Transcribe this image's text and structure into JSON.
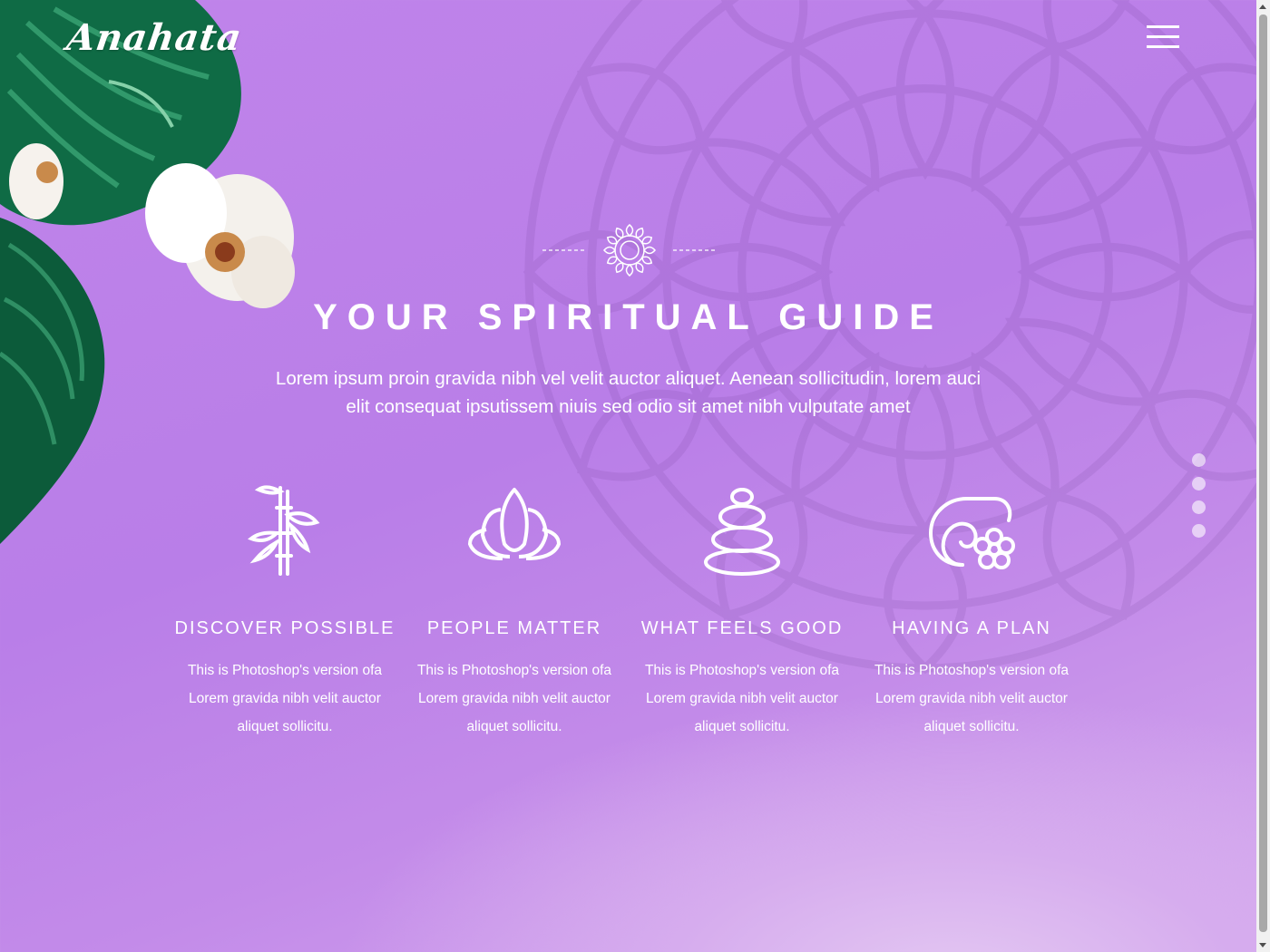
{
  "header": {
    "logo": "Anahata",
    "menu_icon": "hamburger-menu-icon"
  },
  "hero": {
    "ornament_icon": "mandala-flower-icon",
    "title": "YOUR SPIRITUAL GUIDE",
    "subtitle_line1": "Lorem ipsum proin gravida nibh vel velit auctor aliquet. Aenean sollicitudin, lorem auci",
    "subtitle_line2": "elit consequat ipsutissem niuis sed odio sit amet nibh vulputate amet"
  },
  "features": [
    {
      "icon": "bamboo-icon",
      "title": "DISCOVER POSSIBLE",
      "desc_line1": "This is Photoshop's version ofa",
      "desc_line2": "Lorem gravida nibh velit auctor",
      "desc_line3": "aliquet sollicitu."
    },
    {
      "icon": "lotus-icon",
      "title": "PEOPLE MATTER",
      "desc_line1": "This is Photoshop's version ofa",
      "desc_line2": "Lorem gravida nibh velit auctor",
      "desc_line3": "aliquet sollicitu."
    },
    {
      "icon": "stacked-stones-icon",
      "title": "WHAT FEELS GOOD",
      "desc_line1": "This is Photoshop's version ofa",
      "desc_line2": "Lorem gravida nibh velit auctor",
      "desc_line3": "aliquet sollicitu."
    },
    {
      "icon": "towel-flower-icon",
      "title": "HAVING A PLAN",
      "desc_line1": "This is Photoshop's version ofa",
      "desc_line2": "Lorem gravida nibh velit auctor",
      "desc_line3": "aliquet sollicitu."
    }
  ],
  "pagination": {
    "dot_count": 4
  },
  "colors": {
    "background": "#c084ea",
    "text": "#ffffff",
    "leaf": "#0f6b45"
  }
}
